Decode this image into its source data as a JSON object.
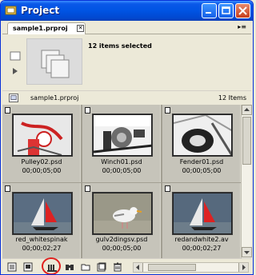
{
  "window": {
    "title": "Project"
  },
  "tab": {
    "label": "sample1.prproj",
    "close_glyph": "✕",
    "menu_glyph": "▸≡"
  },
  "preview": {
    "selection_text": "12 items selected"
  },
  "project_bar": {
    "label": "sample1.prproj",
    "count": "12 Items"
  },
  "clips": [
    {
      "name": "Pulley02.psd",
      "duration": "00;00;05;00"
    },
    {
      "name": "Winch01.psd",
      "duration": "00;00;05;00"
    },
    {
      "name": "Fender01.psd",
      "duration": "00;00;05;00"
    },
    {
      "name": "red_whitespinak",
      "duration": "00;00;02;27"
    },
    {
      "name": "gulv2dingsv.psd",
      "duration": "00;00;05;00"
    },
    {
      "name": "redandwhite2.av",
      "duration": "00;00;02;27"
    }
  ],
  "toolbar": {
    "icons": [
      "list-view-icon",
      "icon-view-icon",
      "automate-to-sequence-icon",
      "find-icon",
      "new-bin-icon",
      "new-item-icon",
      "delete-icon"
    ],
    "highlight_color": "#e0201f"
  }
}
